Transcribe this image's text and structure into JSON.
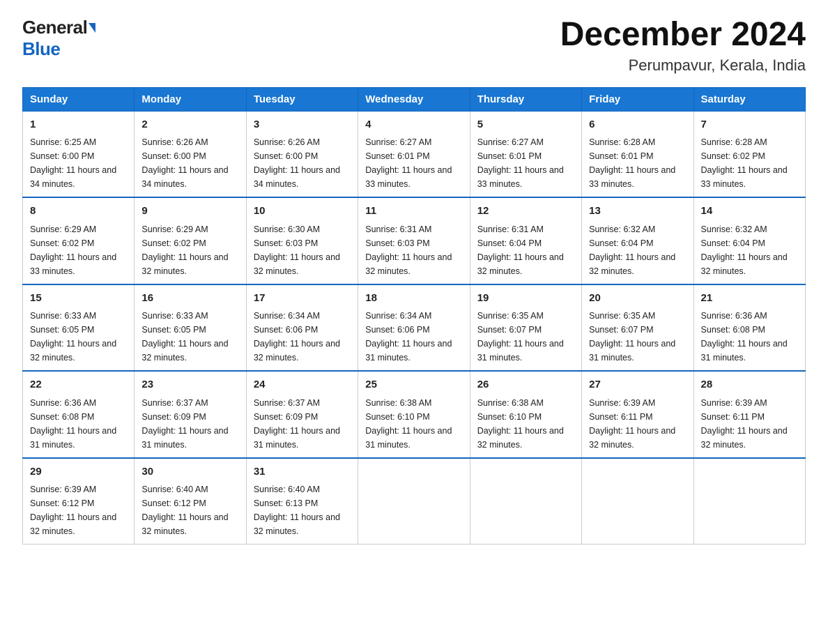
{
  "logo": {
    "general": "General",
    "blue": "Blue"
  },
  "title": "December 2024",
  "subtitle": "Perumpavur, Kerala, India",
  "days_of_week": [
    "Sunday",
    "Monday",
    "Tuesday",
    "Wednesday",
    "Thursday",
    "Friday",
    "Saturday"
  ],
  "weeks": [
    [
      {
        "day": "1",
        "sunrise": "6:25 AM",
        "sunset": "6:00 PM",
        "daylight": "11 hours and 34 minutes."
      },
      {
        "day": "2",
        "sunrise": "6:26 AM",
        "sunset": "6:00 PM",
        "daylight": "11 hours and 34 minutes."
      },
      {
        "day": "3",
        "sunrise": "6:26 AM",
        "sunset": "6:00 PM",
        "daylight": "11 hours and 34 minutes."
      },
      {
        "day": "4",
        "sunrise": "6:27 AM",
        "sunset": "6:01 PM",
        "daylight": "11 hours and 33 minutes."
      },
      {
        "day": "5",
        "sunrise": "6:27 AM",
        "sunset": "6:01 PM",
        "daylight": "11 hours and 33 minutes."
      },
      {
        "day": "6",
        "sunrise": "6:28 AM",
        "sunset": "6:01 PM",
        "daylight": "11 hours and 33 minutes."
      },
      {
        "day": "7",
        "sunrise": "6:28 AM",
        "sunset": "6:02 PM",
        "daylight": "11 hours and 33 minutes."
      }
    ],
    [
      {
        "day": "8",
        "sunrise": "6:29 AM",
        "sunset": "6:02 PM",
        "daylight": "11 hours and 33 minutes."
      },
      {
        "day": "9",
        "sunrise": "6:29 AM",
        "sunset": "6:02 PM",
        "daylight": "11 hours and 32 minutes."
      },
      {
        "day": "10",
        "sunrise": "6:30 AM",
        "sunset": "6:03 PM",
        "daylight": "11 hours and 32 minutes."
      },
      {
        "day": "11",
        "sunrise": "6:31 AM",
        "sunset": "6:03 PM",
        "daylight": "11 hours and 32 minutes."
      },
      {
        "day": "12",
        "sunrise": "6:31 AM",
        "sunset": "6:04 PM",
        "daylight": "11 hours and 32 minutes."
      },
      {
        "day": "13",
        "sunrise": "6:32 AM",
        "sunset": "6:04 PM",
        "daylight": "11 hours and 32 minutes."
      },
      {
        "day": "14",
        "sunrise": "6:32 AM",
        "sunset": "6:04 PM",
        "daylight": "11 hours and 32 minutes."
      }
    ],
    [
      {
        "day": "15",
        "sunrise": "6:33 AM",
        "sunset": "6:05 PM",
        "daylight": "11 hours and 32 minutes."
      },
      {
        "day": "16",
        "sunrise": "6:33 AM",
        "sunset": "6:05 PM",
        "daylight": "11 hours and 32 minutes."
      },
      {
        "day": "17",
        "sunrise": "6:34 AM",
        "sunset": "6:06 PM",
        "daylight": "11 hours and 32 minutes."
      },
      {
        "day": "18",
        "sunrise": "6:34 AM",
        "sunset": "6:06 PM",
        "daylight": "11 hours and 31 minutes."
      },
      {
        "day": "19",
        "sunrise": "6:35 AM",
        "sunset": "6:07 PM",
        "daylight": "11 hours and 31 minutes."
      },
      {
        "day": "20",
        "sunrise": "6:35 AM",
        "sunset": "6:07 PM",
        "daylight": "11 hours and 31 minutes."
      },
      {
        "day": "21",
        "sunrise": "6:36 AM",
        "sunset": "6:08 PM",
        "daylight": "11 hours and 31 minutes."
      }
    ],
    [
      {
        "day": "22",
        "sunrise": "6:36 AM",
        "sunset": "6:08 PM",
        "daylight": "11 hours and 31 minutes."
      },
      {
        "day": "23",
        "sunrise": "6:37 AM",
        "sunset": "6:09 PM",
        "daylight": "11 hours and 31 minutes."
      },
      {
        "day": "24",
        "sunrise": "6:37 AM",
        "sunset": "6:09 PM",
        "daylight": "11 hours and 31 minutes."
      },
      {
        "day": "25",
        "sunrise": "6:38 AM",
        "sunset": "6:10 PM",
        "daylight": "11 hours and 31 minutes."
      },
      {
        "day": "26",
        "sunrise": "6:38 AM",
        "sunset": "6:10 PM",
        "daylight": "11 hours and 32 minutes."
      },
      {
        "day": "27",
        "sunrise": "6:39 AM",
        "sunset": "6:11 PM",
        "daylight": "11 hours and 32 minutes."
      },
      {
        "day": "28",
        "sunrise": "6:39 AM",
        "sunset": "6:11 PM",
        "daylight": "11 hours and 32 minutes."
      }
    ],
    [
      {
        "day": "29",
        "sunrise": "6:39 AM",
        "sunset": "6:12 PM",
        "daylight": "11 hours and 32 minutes."
      },
      {
        "day": "30",
        "sunrise": "6:40 AM",
        "sunset": "6:12 PM",
        "daylight": "11 hours and 32 minutes."
      },
      {
        "day": "31",
        "sunrise": "6:40 AM",
        "sunset": "6:13 PM",
        "daylight": "11 hours and 32 minutes."
      },
      null,
      null,
      null,
      null
    ]
  ],
  "labels": {
    "sunrise": "Sunrise:",
    "sunset": "Sunset:",
    "daylight": "Daylight:"
  }
}
